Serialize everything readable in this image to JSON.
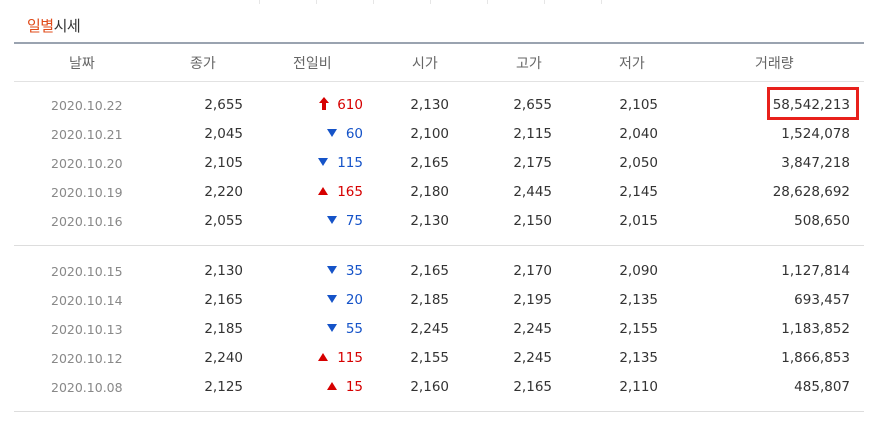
{
  "section": {
    "title_highlight": "일별",
    "title_rest": "시세"
  },
  "columns": [
    "날짜",
    "종가",
    "전일비",
    "시가",
    "고가",
    "저가",
    "거래량"
  ],
  "group1": [
    {
      "date": "2020.10.22",
      "close": "2,655",
      "dir": "up-arrow",
      "change": "610",
      "open": "2,130",
      "high": "2,655",
      "low": "2,105",
      "volume": "58,542,213"
    },
    {
      "date": "2020.10.21",
      "close": "2,045",
      "dir": "down",
      "change": "60",
      "open": "2,100",
      "high": "2,115",
      "low": "2,040",
      "volume": "1,524,078"
    },
    {
      "date": "2020.10.20",
      "close": "2,105",
      "dir": "down",
      "change": "115",
      "open": "2,165",
      "high": "2,175",
      "low": "2,050",
      "volume": "3,847,218"
    },
    {
      "date": "2020.10.19",
      "close": "2,220",
      "dir": "up",
      "change": "165",
      "open": "2,180",
      "high": "2,445",
      "low": "2,145",
      "volume": "28,628,692"
    },
    {
      "date": "2020.10.16",
      "close": "2,055",
      "dir": "down",
      "change": "75",
      "open": "2,130",
      "high": "2,150",
      "low": "2,015",
      "volume": "508,650"
    }
  ],
  "group2": [
    {
      "date": "2020.10.15",
      "close": "2,130",
      "dir": "down",
      "change": "35",
      "open": "2,165",
      "high": "2,170",
      "low": "2,090",
      "volume": "1,127,814"
    },
    {
      "date": "2020.10.14",
      "close": "2,165",
      "dir": "down",
      "change": "20",
      "open": "2,185",
      "high": "2,195",
      "low": "2,135",
      "volume": "693,457"
    },
    {
      "date": "2020.10.13",
      "close": "2,185",
      "dir": "down",
      "change": "55",
      "open": "2,245",
      "high": "2,245",
      "low": "2,155",
      "volume": "1,183,852"
    },
    {
      "date": "2020.10.12",
      "close": "2,240",
      "dir": "up",
      "change": "115",
      "open": "2,155",
      "high": "2,245",
      "low": "2,135",
      "volume": "1,866,853"
    },
    {
      "date": "2020.10.08",
      "close": "2,125",
      "dir": "up",
      "change": "15",
      "open": "2,160",
      "high": "2,165",
      "low": "2,110",
      "volume": "485,807"
    }
  ],
  "colors": {
    "up": "#d60000",
    "down": "#1553c8",
    "title_accent": "#e04b1a",
    "highlight_box": "#e8201b"
  }
}
